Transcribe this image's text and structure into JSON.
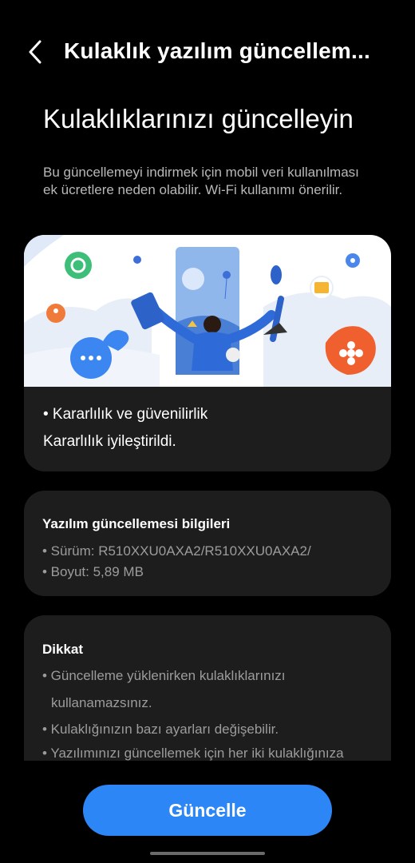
{
  "header": {
    "title": "Kulaklık yazılım güncellem..."
  },
  "main": {
    "headline": "Kulaklıklarınızı güncelleyin",
    "intro": "Bu güncellemeyi indirmek için mobil veri kullanılması ek ücretlere neden olabilir. Wi-Fi kullanımı önerilir."
  },
  "hero": {
    "bullet": "• Kararlılık ve güvenilirlik",
    "detail": "Kararlılık iyileştirildi."
  },
  "info": {
    "title": "Yazılım güncellemesi bilgileri",
    "version": "• Sürüm: R510XXU0AXA2/R510XXU0AXA2/",
    "size": "• Boyut: 5,89 MB"
  },
  "warning": {
    "title": "Dikkat",
    "line1": "• Güncelleme yüklenirken kulaklıklarınızı",
    "line2": "kullanamazsınız.",
    "line3": "• Kulaklığınızın bazı ayarları değişebilir.",
    "line4": "• Yazılımınızı güncellemek için her iki kulaklığınıza"
  },
  "actions": {
    "update_label": "Güncelle"
  },
  "colors": {
    "accent": "#2d86f5",
    "background": "#000000",
    "card": "#1d1d1d"
  }
}
